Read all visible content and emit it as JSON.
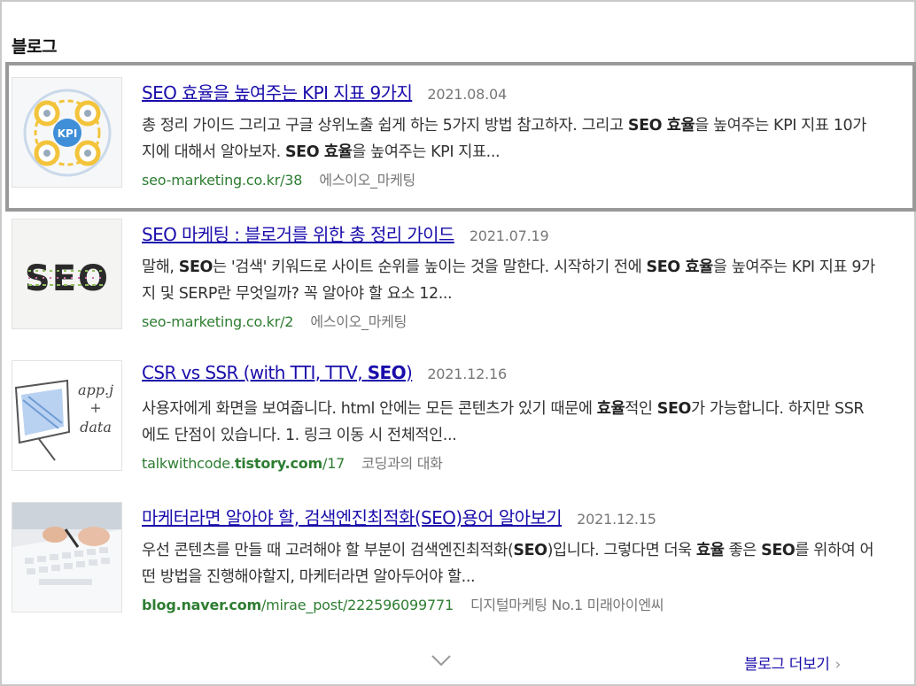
{
  "section": {
    "title": "블로그"
  },
  "results": [
    {
      "title_pre": "SEO 효율을 높여주는 KPI 지표 9가지",
      "date": "2021.08.04",
      "desc": [
        {
          "t": "총 정리 가이드 그리고 구글 상위노출 쉽게 하는 5가지 방법 참고하자. 그리고 ",
          "b": false
        },
        {
          "t": "SEO 효율",
          "b": true
        },
        {
          "t": "을 높여주는 KPI 지표 10가지에 대해서 알아보자. ",
          "b": false
        },
        {
          "t": "SEO 효율",
          "b": true
        },
        {
          "t": "을 높여주는 KPI 지표...",
          "b": false
        }
      ],
      "url": [
        {
          "t": "seo-marketing.co.kr/38",
          "b": false
        }
      ],
      "source": "에스이오_마케팅",
      "thumb_icon": "kpi-diagram-thumbnail",
      "thumb_text": "KPI"
    },
    {
      "title_pre": "SEO 마케팅 : 블로거를 위한 총 정리 가이드",
      "date": "2021.07.19",
      "desc": [
        {
          "t": "말해, ",
          "b": false
        },
        {
          "t": "SEO",
          "b": true
        },
        {
          "t": "는 '검색' 키워드로 사이트 순위를 높이는 것을 말한다. 시작하기 전에 ",
          "b": false
        },
        {
          "t": "SEO 효율",
          "b": true
        },
        {
          "t": "을 높여주는 KPI 지표 9가지 및 SERP란 무엇일까? 꼭 알아야 할 요소 12...",
          "b": false
        }
      ],
      "url": [
        {
          "t": "seo-marketing.co.kr/2",
          "b": false
        }
      ],
      "source": "에스이오_마케팅",
      "thumb_icon": "seo-letters-thumbnail",
      "thumb_text": "SEO"
    },
    {
      "title_pre": "CSR vs SSR (with TTI, TTV, ",
      "title_bold": "SEO",
      "title_post": ")",
      "date": "2021.12.16",
      "desc": [
        {
          "t": "사용자에게 화면을 보여줍니다. html 안에는 모든 콘텐츠가 있기 때문에 ",
          "b": false
        },
        {
          "t": "효율",
          "b": true
        },
        {
          "t": "적인 ",
          "b": false
        },
        {
          "t": "SEO",
          "b": true
        },
        {
          "t": "가 가능합니다. 하지만 SSR에도 단점이 있습니다. 1. 링크 이동 시 전체적인...",
          "b": false
        }
      ],
      "url": [
        {
          "t": "talkwithcode.",
          "b": false
        },
        {
          "t": "tistory.com",
          "b": true
        },
        {
          "t": "/17",
          "b": false
        }
      ],
      "source": "코딩과의 대화",
      "thumb_icon": "app-sketch-thumbnail",
      "thumb_text": "app.js + data"
    },
    {
      "title_pre": "마케터라면 알아야 할, 검색엔진최적화(SEO)용어 알아보기",
      "date": "2021.12.15",
      "desc": [
        {
          "t": "우선 콘텐츠를 만들 때 고려해야 할 부분이 검색엔진최적화(",
          "b": false
        },
        {
          "t": "SEO",
          "b": true
        },
        {
          "t": ")입니다. 그렇다면 더욱 ",
          "b": false
        },
        {
          "t": "효율",
          "b": true
        },
        {
          "t": " 좋은 ",
          "b": false
        },
        {
          "t": "SEO",
          "b": true
        },
        {
          "t": "를 위하여 어떤 방법을 진행해야할지, 마케터라면 알아두어야 할...",
          "b": false
        }
      ],
      "url": [
        {
          "t": "blog.naver.com",
          "b": true
        },
        {
          "t": "/mirae_post/222596099771",
          "b": false
        }
      ],
      "source": "디지털마케팅 No.1 미래아이엔씨",
      "thumb_icon": "keyboard-photo-thumbnail",
      "thumb_text": ""
    }
  ],
  "footer": {
    "more_label": "블로그 더보기",
    "more_arrow": "›",
    "expand_icon": "chevron-down-icon"
  },
  "colors": {
    "link": "#1a0dab",
    "url": "#2e7d32",
    "muted": "#777777",
    "highlight_border": "#999999"
  }
}
